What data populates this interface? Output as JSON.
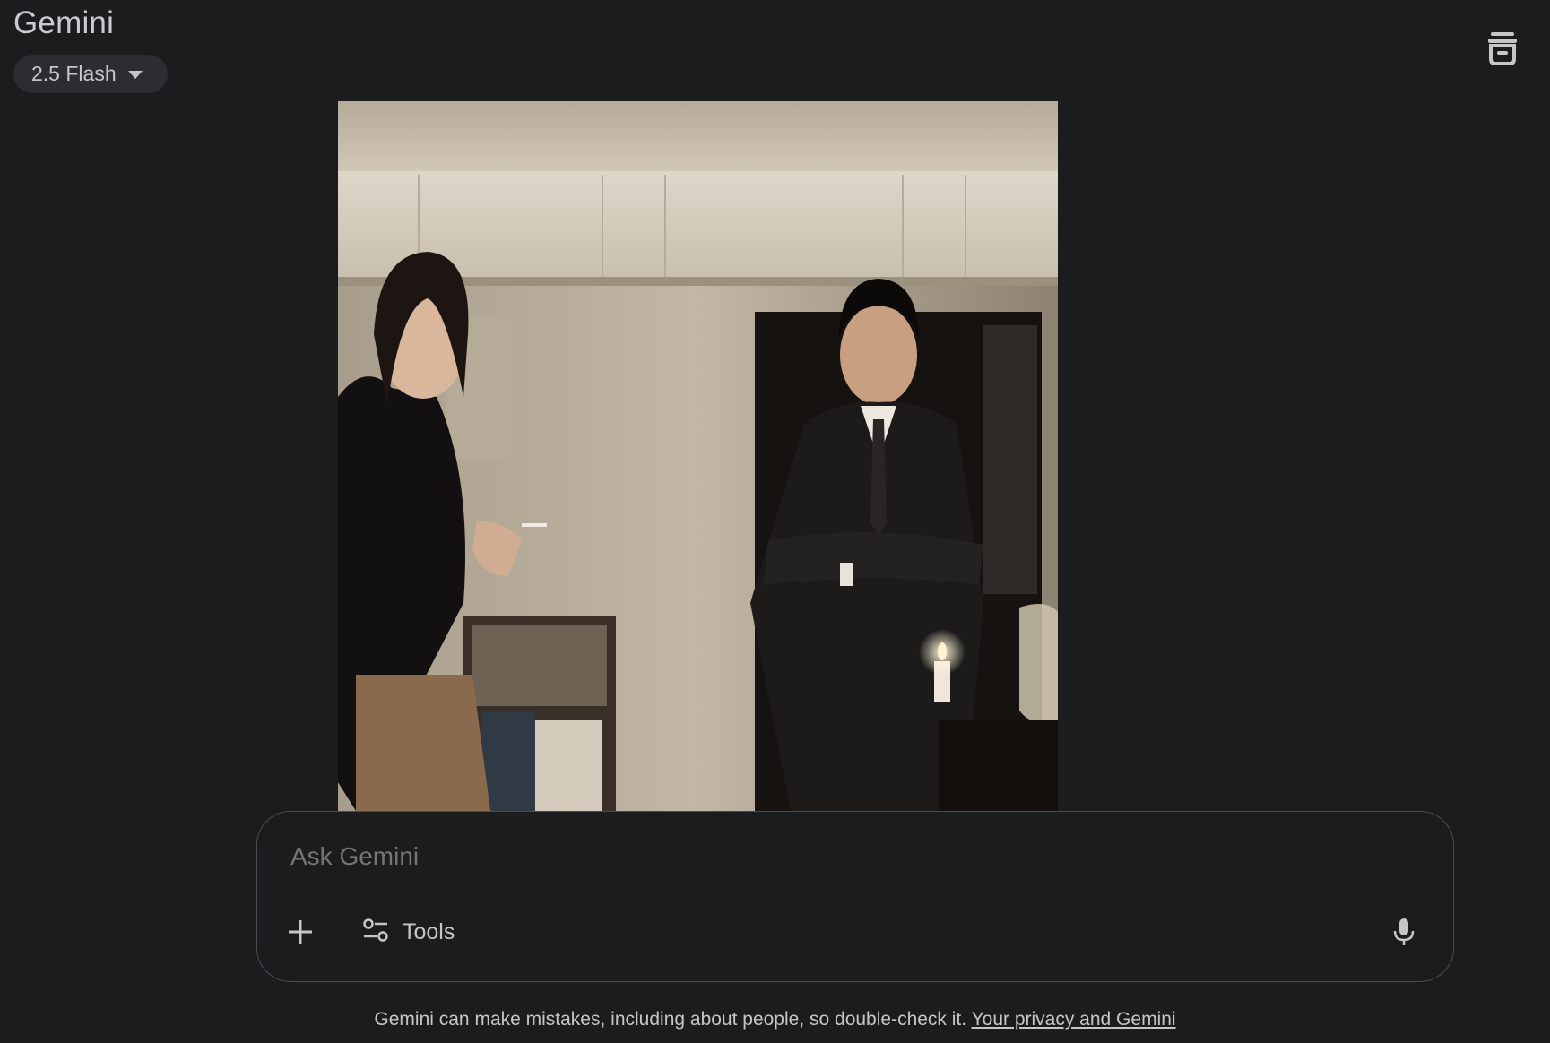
{
  "header": {
    "app_title": "Gemini",
    "model_selector": {
      "label": "2.5 Flash",
      "icon": "chevron-down-icon"
    },
    "top_right_icon": "temporary-chat-icon"
  },
  "main": {
    "image": {
      "icon": "generated-image",
      "description_free": true
    }
  },
  "composer": {
    "placeholder": "Ask Gemini",
    "value": "",
    "plus_icon": "plus-icon",
    "tools_label": "Tools",
    "tools_icon": "tools-icon",
    "mic_icon": "mic-icon"
  },
  "footer": {
    "disclaimer_text": "Gemini can make mistakes, including about people, so double-check it. ",
    "privacy_link": "Your privacy and Gemini"
  },
  "colors": {
    "background": "#1b1c1e",
    "chip_background": "#2b2d30",
    "text": "#c4c7c5",
    "composer_border": "#4a4c4f"
  }
}
